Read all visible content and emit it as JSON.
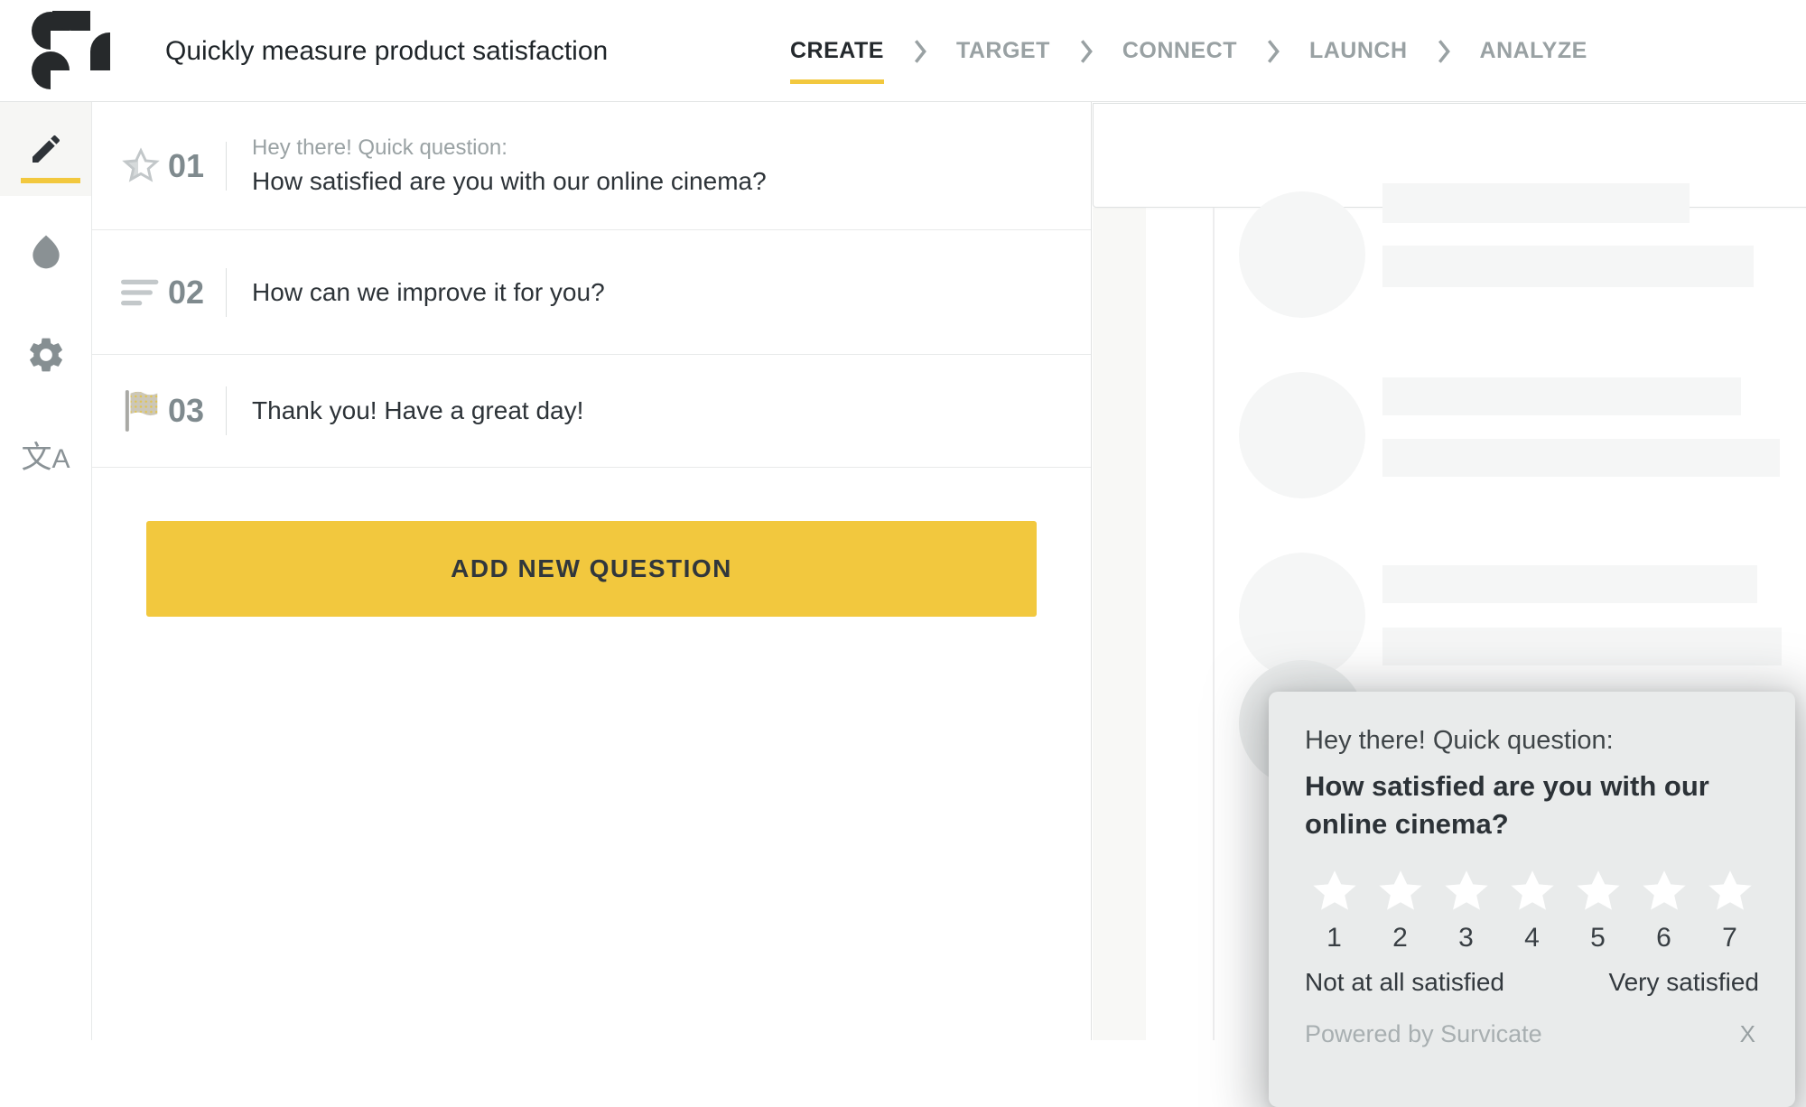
{
  "header": {
    "survey_title": "Quickly measure product satisfaction",
    "steps": [
      {
        "label": "CREATE",
        "active": true
      },
      {
        "label": "TARGET",
        "active": false
      },
      {
        "label": "CONNECT",
        "active": false
      },
      {
        "label": "LAUNCH",
        "active": false
      },
      {
        "label": "ANALYZE",
        "active": false
      }
    ]
  },
  "sidebar": {
    "items": [
      {
        "icon": "pencil-icon",
        "active": true
      },
      {
        "icon": "droplet-icon",
        "active": false
      },
      {
        "icon": "gear-icon",
        "active": false
      },
      {
        "icon": "translate-icon",
        "active": false
      }
    ],
    "translate_glyph_cjk": "文",
    "translate_glyph_latin": "A"
  },
  "questions": [
    {
      "number": "01",
      "icon": "star-icon",
      "intro": "Hey there! Quick question:",
      "text": "How satisfied are you with our online cinema?"
    },
    {
      "number": "02",
      "icon": "text-lines-icon",
      "intro": "",
      "text": "How can we improve it for you?"
    },
    {
      "number": "03",
      "icon": "flag-icon",
      "intro": "",
      "text": "Thank you! Have a great day!"
    }
  ],
  "add_question_label": "ADD NEW QUESTION",
  "preview_card": {
    "intro": "Hey there! Quick question:",
    "question": "How satisfied are you with our online cinema?",
    "scale": [
      "1",
      "2",
      "3",
      "4",
      "5",
      "6",
      "7"
    ],
    "min_label": "Not at all satisfied",
    "max_label": "Very satisfied",
    "powered_by": "Powered by Survicate",
    "close_label": "X"
  },
  "colors": {
    "accent_yellow": "#F2C83E",
    "dark_text": "#2D3338",
    "muted_text": "#99A1A3",
    "card_background": "#E9EBEB",
    "skeleton": "#F5F6F6"
  }
}
